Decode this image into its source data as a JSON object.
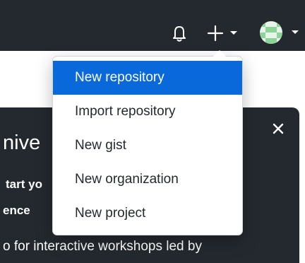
{
  "header": {
    "icons": {
      "notifications": "bell-icon",
      "create": "plus-icon",
      "create_caret": "caret-down-icon",
      "avatar": "avatar-identicon",
      "avatar_caret": "caret-down-icon"
    }
  },
  "create_menu": {
    "items": [
      {
        "label": "New repository",
        "active": true
      },
      {
        "label": "Import repository",
        "active": false
      },
      {
        "label": "New gist",
        "active": false
      },
      {
        "label": "New organization",
        "active": false
      },
      {
        "label": "New project",
        "active": false
      }
    ]
  },
  "background_card": {
    "heading_fragment": "nive",
    "line1_fragment": "tart yo",
    "line2_fragment": "ence",
    "line3_fragment": "o for interactive workshops led by",
    "close_icon": "close-icon"
  },
  "colors": {
    "header_bg": "#24292f",
    "active_item_bg": "#0969da",
    "active_item_text": "#ffffff",
    "menu_text": "#24292f",
    "avatar_green": "#8ed39a"
  }
}
